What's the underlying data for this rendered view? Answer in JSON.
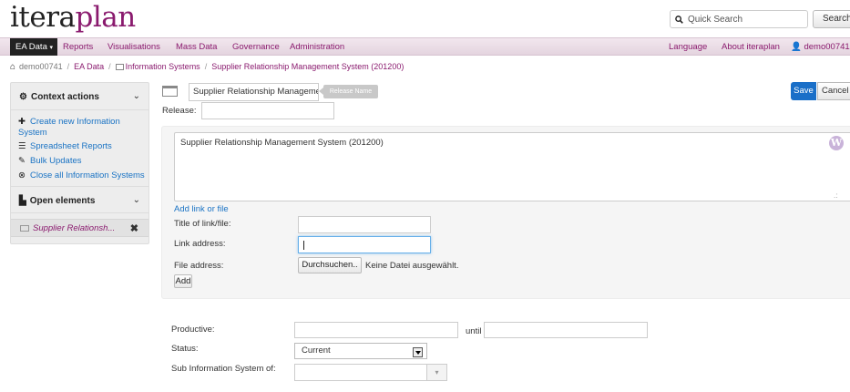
{
  "app": {
    "logo_part1": "itera",
    "logo_part2": "plan"
  },
  "search": {
    "placeholder": "Quick Search",
    "button": "Search"
  },
  "nav": {
    "items": [
      "EA Data",
      "Reports",
      "Visualisations",
      "Mass Data",
      "Governance",
      "Administration"
    ],
    "right": [
      "Language",
      "About iteraplan",
      "demo00741"
    ]
  },
  "breadcrumb": [
    "demo00741",
    "EA Data",
    "Information Systems",
    "Supplier Relationship Management System (201200)"
  ],
  "sidebar": {
    "context_title": "Context actions",
    "links": [
      "Create new Information",
      "System",
      "Spreadsheet Reports",
      "Bulk Updates",
      "Close all Information Systems"
    ],
    "open_title": "Open elements",
    "open_item": "Supplier Relationsh..."
  },
  "form": {
    "name_value": "Supplier Relationship Management System",
    "release_tooltip": "Release Name",
    "release_label": "Release:",
    "release_value": "",
    "save": "Save",
    "cancel": "Cancel",
    "description": "Supplier Relationship Management System (201200)",
    "add_link": "Add link or file",
    "link_title_label": "Title of link/file:",
    "link_address_label": "Link address:",
    "file_address_label": "File address:",
    "browse_button": "Durchsuchen..",
    "no_file": "Keine Datei ausgewählt.",
    "add_button": "Add",
    "productive_label": "Productive:",
    "until_label": "until",
    "status_label": "Status:",
    "status_value": "Current",
    "sub_label": "Sub Information System of:"
  },
  "colors": {
    "brand": "#8a1a6e",
    "link": "#1a73c4",
    "primary": "#1a6fc8"
  }
}
